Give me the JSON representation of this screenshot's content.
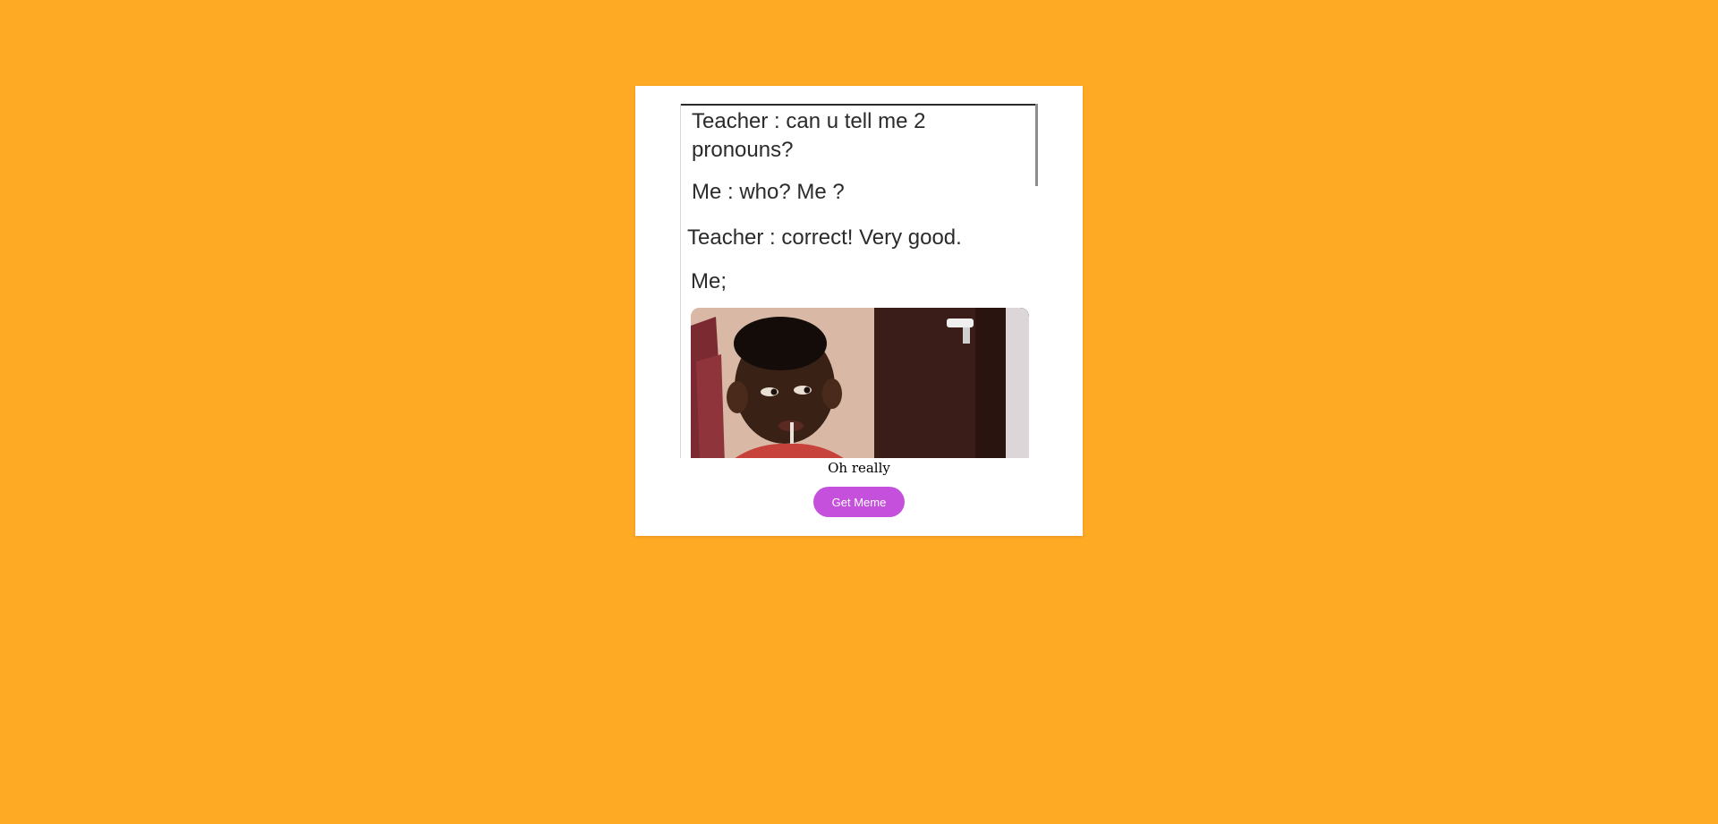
{
  "meme": {
    "lines": [
      "Teacher : can u  tell me 2",
      "pronouns?",
      "Me : who? Me ?",
      "Teacher : correct! Very good.",
      "Me;"
    ],
    "caption": "Oh really"
  },
  "controls": {
    "get_meme_label": "Get Meme"
  },
  "colors": {
    "background": "#FFAA25",
    "card": "#FFFFFF",
    "button": "#C450DB"
  }
}
